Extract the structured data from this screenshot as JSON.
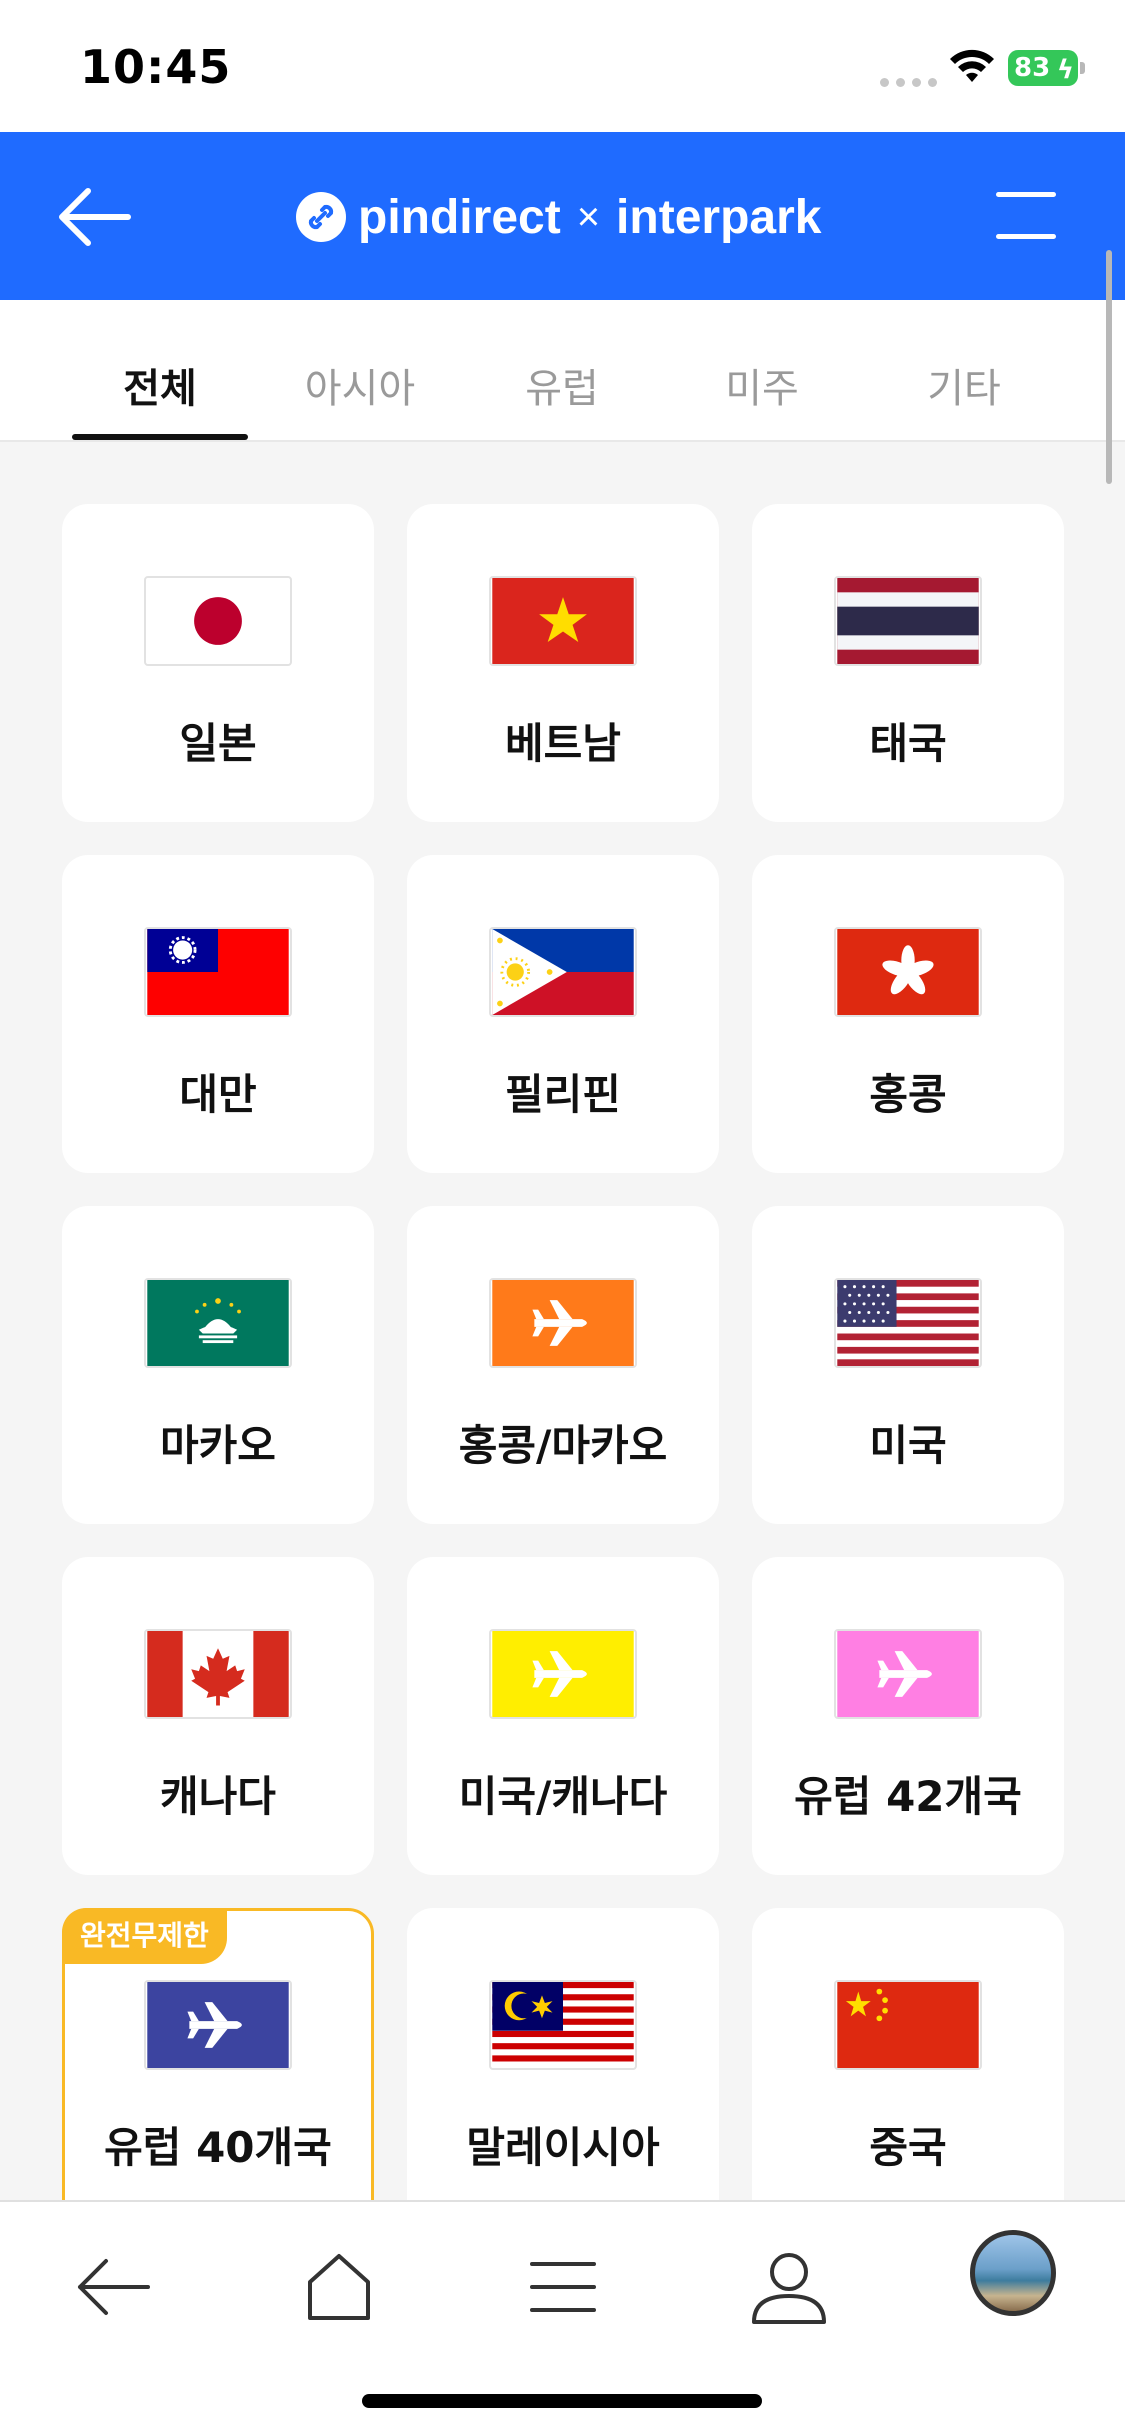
{
  "status_bar": {
    "time": "10:45",
    "battery": "83"
  },
  "header": {
    "brand": "pindirect",
    "separator": "×",
    "partner": "interpark",
    "colors": {
      "background": "#1f6bff"
    }
  },
  "tabs": [
    {
      "label": "전체",
      "active": true
    },
    {
      "label": "아시아",
      "active": false
    },
    {
      "label": "유럽",
      "active": false
    },
    {
      "label": "미주",
      "active": false
    },
    {
      "label": "기타",
      "active": false
    }
  ],
  "destinations": [
    {
      "label": "일본",
      "flag": "japan-flag"
    },
    {
      "label": "베트남",
      "flag": "vietnam-flag"
    },
    {
      "label": "태국",
      "flag": "thailand-flag"
    },
    {
      "label": "대만",
      "flag": "taiwan-flag"
    },
    {
      "label": "필리핀",
      "flag": "philippines-flag"
    },
    {
      "label": "홍콩",
      "flag": "hongkong-flag"
    },
    {
      "label": "마카오",
      "flag": "macau-flag"
    },
    {
      "label": "홍콩/마카오",
      "flag": "airplane-orange-icon"
    },
    {
      "label": "미국",
      "flag": "usa-flag"
    },
    {
      "label": "캐나다",
      "flag": "canada-flag"
    },
    {
      "label": "미국/캐나다",
      "flag": "airplane-yellow-icon"
    },
    {
      "label": "유럽 42개국",
      "flag": "airplane-pink-icon"
    },
    {
      "label": "유럽 40개국",
      "flag": "airplane-navy-icon",
      "badge": "완전무제한"
    },
    {
      "label": "말레이시아",
      "flag": "malaysia-flag"
    },
    {
      "label": "중국",
      "flag": "china-flag"
    }
  ],
  "colors": {
    "badge": "#f9b925",
    "accent": "#1f6bff"
  },
  "bottom_nav": [
    "back-icon",
    "home-icon",
    "menu-icon",
    "profile-icon",
    "avatar"
  ]
}
